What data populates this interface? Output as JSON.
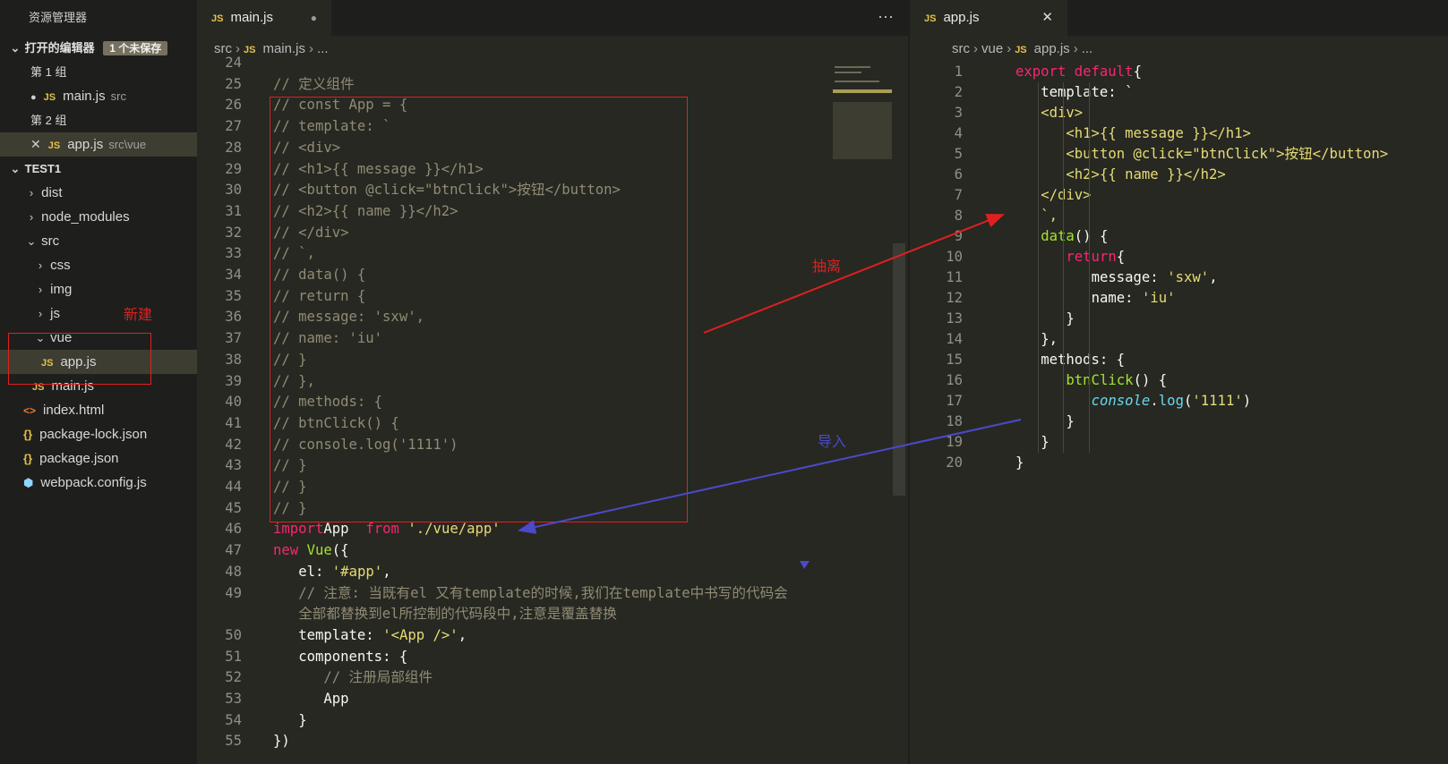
{
  "sidebar": {
    "title": "资源管理器",
    "open_editors_label": "打开的编辑器",
    "unsaved_badge": "1 个未保存",
    "group1": "第 1 组",
    "group1_file": "main.js",
    "group1_path": "src",
    "group2": "第 2 组",
    "group2_file": "app.js",
    "group2_path": "src\\vue",
    "project": "TEST1",
    "tree": {
      "dist": "dist",
      "node_modules": "node_modules",
      "src": "src",
      "css": "css",
      "img": "img",
      "js": "js",
      "vue": "vue",
      "app": "app.js",
      "main": "main.js",
      "index": "index.html",
      "pkglock": "package-lock.json",
      "pkg": "package.json",
      "webpack": "webpack.config.js"
    },
    "icons": {
      "js": "JS",
      "html": "<>",
      "json": "{}",
      "webpack": "⬢"
    },
    "annotation_new": "新建"
  },
  "left_editor": {
    "tab_label": "main.js",
    "tab_dot": "●",
    "more": "···",
    "breadcrumb": [
      "src",
      "main.js",
      "..."
    ],
    "line_numbers": [
      "24",
      "25",
      "26",
      "27",
      "28",
      "29",
      "30",
      "31",
      "32",
      "33",
      "34",
      "35",
      "36",
      "37",
      "38",
      "39",
      "40",
      "41",
      "42",
      "43",
      "44",
      "45",
      "46",
      "47",
      "48",
      "49",
      "",
      "50",
      "51",
      "52",
      "53",
      "54",
      "55"
    ],
    "lines": [
      "",
      "// 定义组件",
      "// const App = {",
      "//    template: `",
      "//    <div>",
      "//       <h1>{{ message }}</h1>",
      "//       <button @click=\"btnClick\">按钮</button>",
      "//       <h2>{{ name }}</h2>",
      "//    </div>",
      "//    `,",
      "//    data() {",
      "//       return {",
      "//          message: 'sxw',",
      "//          name: 'iu'",
      "//       }",
      "//    },",
      "//    methods: {",
      "//       btnClick() {",
      "//          console.log('1111')",
      "//       }",
      "//    }",
      "// }"
    ],
    "import_kw": "import",
    "import_name": " App ",
    "import_from": "from",
    "import_path": "'./vue/app'",
    "new_kw": "new",
    "vue_cls": "Vue",
    "vue_open": "({",
    "el_key": "el: ",
    "el_val": "'#app'",
    "comma": ",",
    "note1": "// 注意: 当既有el 又有template的时候,我们在template中书写的代码会",
    "note2": "全部都替换到el所控制的代码段中,注意是覆盖替换",
    "tpl_key": "template: ",
    "tpl_val": "'<App />'",
    "comp_key": "components: {",
    "comp_comment": "// 注册局部组件",
    "comp_app": "App",
    "comp_close": "}",
    "close_all": "})",
    "annotation_extract": "抽离",
    "annotation_import": "导入"
  },
  "right_editor": {
    "tab_label": "app.js",
    "tab_close": "✕",
    "breadcrumb": [
      "src",
      "vue",
      "app.js",
      "..."
    ],
    "line_numbers": [
      "1",
      "2",
      "3",
      "4",
      "5",
      "6",
      "7",
      "8",
      "9",
      "10",
      "11",
      "12",
      "13",
      "14",
      "15",
      "16",
      "17",
      "18",
      "19",
      "20"
    ],
    "l1_kw": "export default",
    "l1_rest": " {",
    "l2": "template: `",
    "l3": "<div>",
    "l4": "<h1>{{ message }}</h1>",
    "l5": "<button @click=\"btnClick\">按钮</button>",
    "l6": "<h2>{{ name }}</h2>",
    "l7": "</div>",
    "l8": "`,",
    "l9_fn": "data",
    "l9_rest": "() {",
    "l10_kw": "return",
    "l10_rest": " {",
    "l11_key": "message: ",
    "l11_val": "'sxw'",
    "l11_end": ",",
    "l12_key": "name: ",
    "l12_val": "'iu'",
    "l13": "}",
    "l14": "},",
    "l15": "methods: {",
    "l16_fn": "btnClick",
    "l16_rest": "() {",
    "l17_obj": "console",
    "l17_dot": ".",
    "l17_fn": "log",
    "l17_open": "(",
    "l17_val": "'1111'",
    "l17_close": ")",
    "l18": "}",
    "l19": "}",
    "l20": "}"
  },
  "colors": {
    "keyword": "#f92672",
    "string": "#e6db74",
    "function": "#a6e22e",
    "comment": "#908b74",
    "annotation_red": "#e02020",
    "annotation_blue": "#4a4acb"
  }
}
